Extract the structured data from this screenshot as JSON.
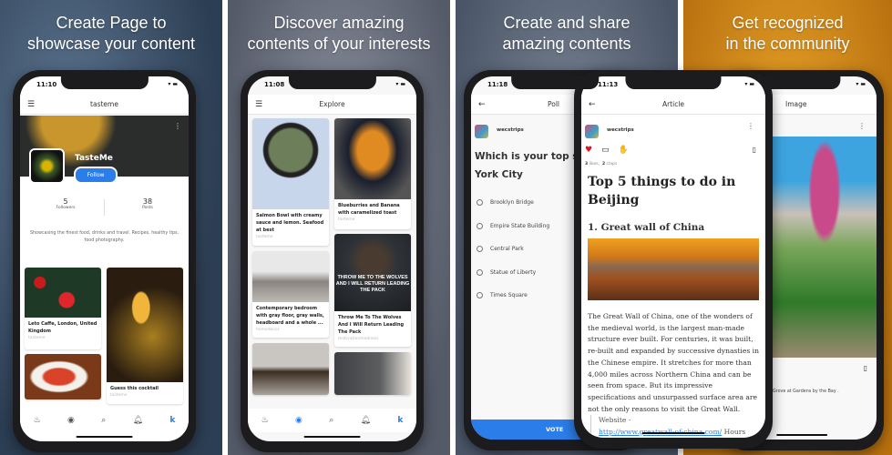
{
  "panels": [
    {
      "headline": [
        "Create Page to",
        "showcase your content"
      ],
      "background": "#3a5068"
    },
    {
      "headline": [
        "Discover amazing",
        "contents of your interests"
      ],
      "background": "#6d7482"
    },
    {
      "headline": [
        "Create and share",
        "amazing contents"
      ],
      "background": "#5d6a7a"
    },
    {
      "headline": [
        "Get recognized",
        "in the community"
      ],
      "background": "#d9931c"
    }
  ],
  "profile": {
    "time": "11:10",
    "title": "tasteme",
    "page_name": "TasteMe",
    "follow_label": "Follow",
    "followers_count": "5",
    "followers_label": "Followers",
    "posts_count": "38",
    "posts_label": "Posts",
    "bio": "Showcasing the finest food, drinks and travel. Recipes, healthy tips, food photography.",
    "cards": [
      {
        "title": "Leto Caffe, London, United Kingdom",
        "author": "tasteme"
      },
      {
        "title": "Guess this cocktail",
        "author": "tasteme"
      }
    ]
  },
  "explore": {
    "time": "11:08",
    "title": "Explore",
    "cards": [
      {
        "title": "Salmon Bowl with creamy sauce and lemon. Seafood at best",
        "author": "tasteme"
      },
      {
        "title": "Blueburries and Banana with caramelized toast",
        "author": "tasteme"
      },
      {
        "title": "Contemporary bedroom with gray floor, gray walls, headboard and a whole ...",
        "author": "homedecor"
      },
      {
        "title": "Throw Me To The Wolves And I Will Return Leading The Pack",
        "author": "motivationmadness",
        "overlay": "THROW ME TO THE WOLVES AND I WILL RETURN LEADING THE PACK"
      }
    ]
  },
  "nav": {
    "items": [
      "flame",
      "compass",
      "search",
      "bell",
      "k"
    ],
    "active_profile": "k",
    "active_explore": "compass"
  },
  "poll": {
    "time": "11:18",
    "title": "Poll",
    "author": "wecstrips",
    "question": "Which is your top sight in New York City",
    "options": [
      "Brooklyn Bridge",
      "Empire State Building",
      "Central Park",
      "Statue of Liberty",
      "Times Square"
    ],
    "vote_label": "VOTE"
  },
  "article": {
    "time": "11:13",
    "title": "Article",
    "author": "wecstrips",
    "likes": "3",
    "likes_label": "likes,",
    "claps": "2",
    "claps_label": "claps",
    "heading": "Top 5 things to do in Beijing",
    "subheading": "1. Great wall of China",
    "body": "The Great Wall of China, one of the wonders of the medieval world, is the largest man-made structure ever built. For centuries, it was built, re-built and expanded by successive dynasties in the Chinese empire. It stretches for more than 4,000 miles across Northern China and can be seen from space. But its impressive specifications and unsurpassed surface area are not the only reasons to visit the Great Wall.",
    "website_label": "Website -",
    "website_link": "http://www.greatwall-of-china.com/",
    "hours_label": "Hours"
  },
  "image_post": {
    "title": "Image",
    "caption": "Grove at Gardens by the Bay ."
  },
  "colors": {
    "accent": "#2b7de9",
    "heart": "#e0141e"
  }
}
